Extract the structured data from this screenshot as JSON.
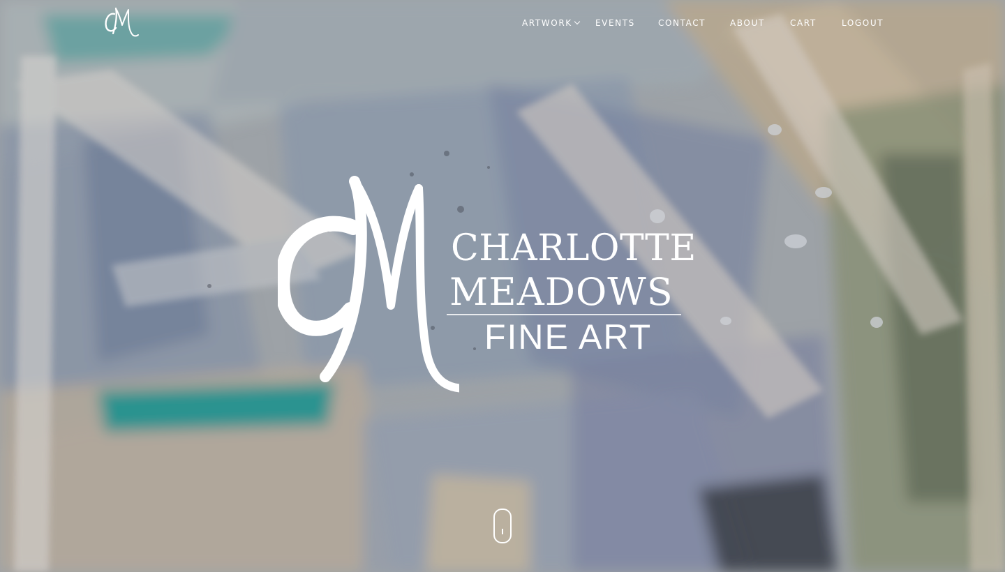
{
  "header": {
    "logo_alt": "CM",
    "nav": [
      {
        "label": "ARTWORK",
        "has_dropdown": true
      },
      {
        "label": "EVENTS"
      },
      {
        "label": "CONTACT"
      },
      {
        "label": "ABOUT"
      },
      {
        "label": "CART"
      },
      {
        "label": "LOGOUT"
      }
    ]
  },
  "hero": {
    "brand_first": "CHARLOTTE",
    "brand_last": "MEADOWS",
    "brand_sub": "FINE ART",
    "monogram": "CM",
    "scroll_icon": "mouse-scroll-icon"
  },
  "colors": {
    "text": "#ffffff",
    "teal": "#1f9d96",
    "slate_blue": "#6f7ea8",
    "sand": "#c9b79c",
    "olive": "#7d8a68"
  }
}
